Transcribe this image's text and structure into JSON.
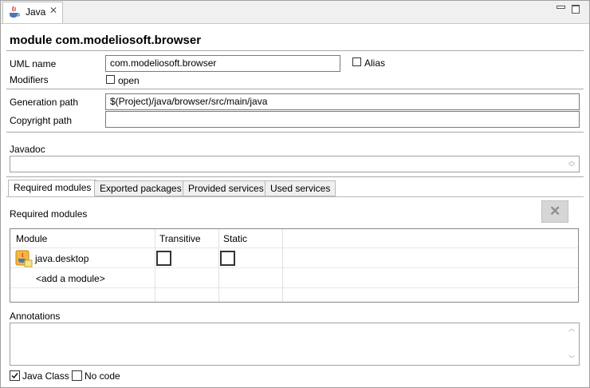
{
  "view": {
    "tab_label": "Java"
  },
  "header": {
    "title": "module com.modeliosoft.browser"
  },
  "form": {
    "uml_name_label": "UML name",
    "uml_name_value": "com.modeliosoft.browser",
    "alias_label": "Alias",
    "modifiers_label": "Modifiers",
    "open_label": "open",
    "generation_path_label": "Generation path",
    "generation_path_value": "$(Project)/java/browser/src/main/java",
    "copyright_path_label": "Copyright path",
    "copyright_path_value": "",
    "javadoc_label": "Javadoc",
    "javadoc_value": ""
  },
  "tabs": [
    {
      "label": "Required modules",
      "active": true
    },
    {
      "label": "Exported packages",
      "active": false
    },
    {
      "label": "Provided services",
      "active": false
    },
    {
      "label": "Used services",
      "active": false
    }
  ],
  "required": {
    "section_label": "Required modules",
    "columns": [
      "Module",
      "Transitive",
      "Static"
    ],
    "rows": [
      {
        "module": "java.desktop",
        "transitive": false,
        "static": false
      }
    ],
    "add_row_label": "<add a module>"
  },
  "annotations": {
    "label": "Annotations",
    "value": ""
  },
  "footer": {
    "java_class_label": "Java Class",
    "java_class_checked": true,
    "no_code_label": "No code",
    "no_code_checked": false
  }
}
